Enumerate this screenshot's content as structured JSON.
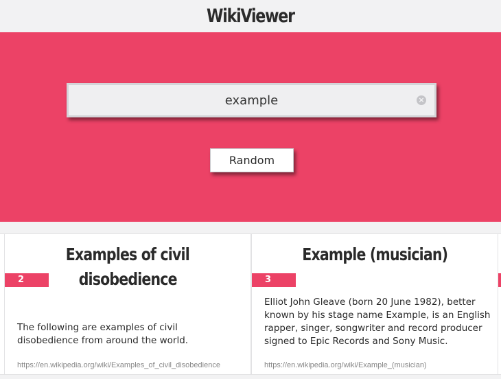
{
  "app": {
    "title": "WikiViewer"
  },
  "search": {
    "value": "example",
    "clear_icon": "clear-circle-icon"
  },
  "random_button": {
    "label": "Random"
  },
  "colors": {
    "accent": "#ec4266",
    "background": "#f2f2f3",
    "card": "#ffffff"
  },
  "results": [
    {
      "index": "2",
      "title_line1": "Examples of civil",
      "title_line2": "disobedience",
      "extract": "The following are examples of civil disobedience from around the world.",
      "url": "https://en.wikipedia.org/wiki/Examples_of_civil_disobedience"
    },
    {
      "index": "3",
      "title_line1": "Example (musician)",
      "title_line2": "",
      "extract": "Elliot John Gleave (born 20 June 1982), better known by his stage name Example, is an English rapper, singer, songwriter and record producer signed to Epic Records and Sony Music.",
      "url": "https://en.wikipedia.org/wiki/Example_(musician)"
    }
  ]
}
